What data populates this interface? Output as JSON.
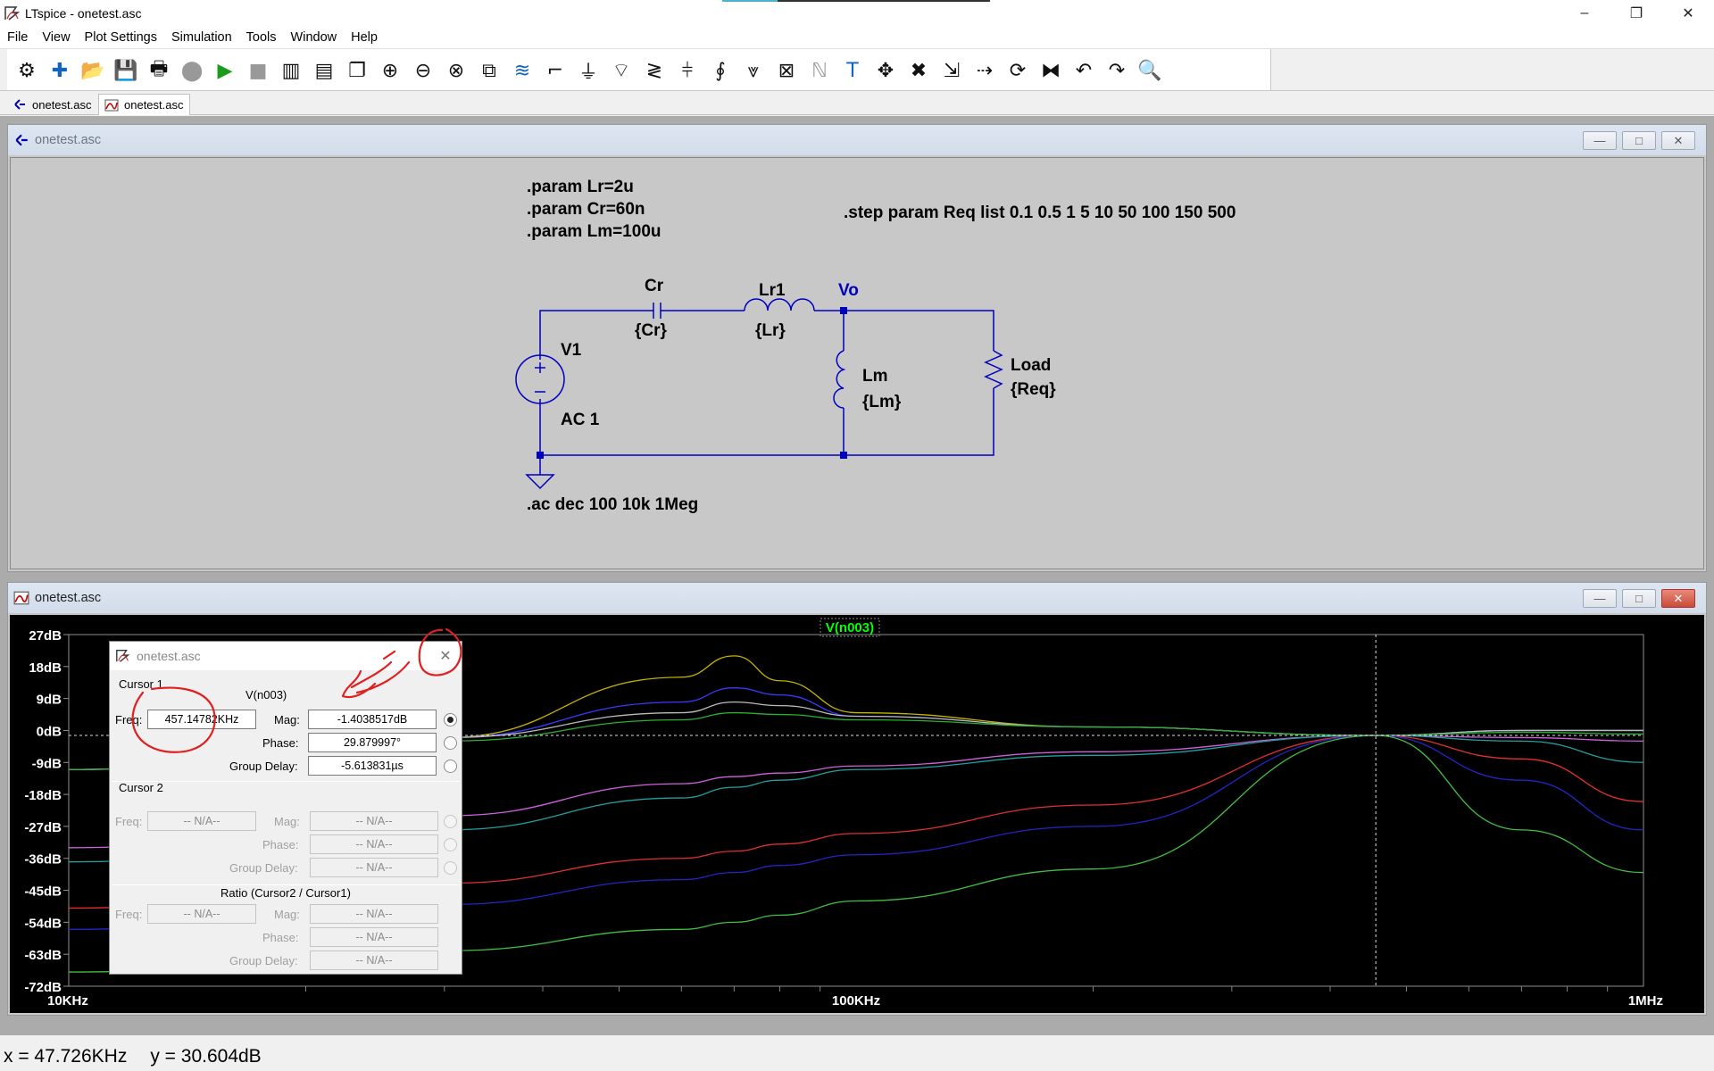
{
  "window": {
    "title": "LTspice - onetest.asc"
  },
  "menu": [
    "File",
    "View",
    "Plot Settings",
    "Simulation",
    "Tools",
    "Window",
    "Help"
  ],
  "toolbar": {
    "icons": [
      "gear-icon",
      "new-schematic-icon",
      "open-icon",
      "save-icon",
      "print-icon",
      "halt-icon",
      "run-icon",
      "stop-icon",
      "tile-vertical-icon",
      "tile-horizontal-icon",
      "cascade-icon",
      "zoom-in-icon",
      "zoom-out-icon",
      "zoom-fit-icon",
      "zoom-extents-icon",
      "autorange-icon",
      "wire-icon",
      "ground-icon",
      "label-net-icon",
      "resistor-icon",
      "capacitor-icon",
      "inductor-icon",
      "diode-icon",
      "component-icon",
      "spice-directive-icon",
      "text-icon",
      "move-icon",
      "delete-icon",
      "duplicate-icon",
      "drag-icon",
      "rotate-icon",
      "mirror-icon",
      "undo-icon",
      "redo-icon",
      "find-icon"
    ]
  },
  "tabs": [
    {
      "label": "onetest.asc",
      "icon": "schematic-icon"
    },
    {
      "label": "onetest.asc",
      "icon": "waveform-icon",
      "active": true
    }
  ],
  "schematic": {
    "title": "onetest.asc",
    "directives": [
      ".param Lr=2u",
      ".param Cr=60n",
      ".param Lm=100u"
    ],
    "step": ".step param Req list 0.1 0.5 1 5 10 50 100 150 500",
    "ac": ".ac dec 100 10k 1Meg",
    "components": {
      "cr_name": "Cr",
      "cr_value": "{Cr}",
      "lr_name": "Lr1",
      "lr_value": "{Lr}",
      "vo_label": "Vo",
      "lm_name": "Lm",
      "lm_value": "{Lm}",
      "load_name": "Load",
      "load_value": "{Req}",
      "v1_name": "V1",
      "v1_value": "AC 1"
    },
    "colors": {
      "wire": "#0000c0",
      "text": "#000000",
      "background": "#c8c8c8"
    }
  },
  "plot": {
    "title": "onetest.asc",
    "trace_label": "V(n003)",
    "y_ticks": [
      "27dB",
      "18dB",
      "9dB",
      "0dB",
      "-9dB",
      "-18dB",
      "-27dB",
      "-36dB",
      "-45dB",
      "-54dB",
      "-63dB",
      "-72dB"
    ],
    "x_ticks": [
      "10KHz",
      "100KHz",
      "1MHz"
    ],
    "colors": {
      "background": "#000000",
      "grid": "#808080",
      "trace_label": "#00ff00",
      "axis_text": "#ffffff"
    }
  },
  "chart_data": {
    "type": "line",
    "title": "V(n003)",
    "xlabel": "",
    "ylabel": "",
    "x_scale": "log",
    "xlim": [
      10000,
      1000000
    ],
    "ylim": [
      -72,
      27
    ],
    "cursor_x": 457147.82,
    "x": [
      10000,
      30000,
      60000,
      70000,
      80000,
      100000,
      200000,
      457148,
      700000,
      1000000
    ],
    "series": [
      {
        "color": "#c8b400",
        "values": [
          -11,
          -2,
          15,
          21,
          14,
          5,
          1,
          -1.4,
          0,
          0
        ]
      },
      {
        "color": "#3a3aff",
        "values": [
          -11,
          -2,
          8,
          12,
          10,
          4,
          1,
          -1.4,
          0,
          0
        ]
      },
      {
        "color": "#bbbbbb",
        "values": [
          -11,
          -2,
          5,
          8,
          7,
          4,
          1,
          -1.4,
          0,
          0
        ]
      },
      {
        "color": "#2ab030",
        "values": [
          -11,
          -3,
          3,
          5,
          4.5,
          3,
          1,
          -1.4,
          -0.5,
          -1
        ]
      },
      {
        "color": "#d060e0",
        "values": [
          -33,
          -24,
          -15,
          -13,
          -12,
          -10,
          -6,
          -1.4,
          -2,
          -3
        ]
      },
      {
        "color": "#20a0a0",
        "values": [
          -37,
          -28,
          -19,
          -16,
          -14,
          -11,
          -7,
          -1.4,
          -3,
          -9
        ]
      },
      {
        "color": "#e03030",
        "values": [
          -50,
          -43,
          -36,
          -34,
          -32,
          -29,
          -21,
          -1.4,
          -8,
          -20
        ]
      },
      {
        "color": "#2424c8",
        "values": [
          -56,
          -49,
          -42,
          -40,
          -38,
          -35,
          -27,
          -1.4,
          -14,
          -28
        ]
      },
      {
        "color": "#40c040",
        "values": [
          -68,
          -62,
          -56,
          -54,
          -52,
          -48,
          -39,
          -1.4,
          -28,
          -40
        ]
      }
    ]
  },
  "cursor_dialog": {
    "title": "onetest.asc",
    "cursor1_label": "Cursor 1",
    "trace": "V(n003)",
    "freq_label": "Freq:",
    "freq": "457.14782KHz",
    "mag_label": "Mag:",
    "mag": "-1.4038517dB",
    "phase_label": "Phase:",
    "phase": "29.879997°",
    "gd_label": "Group Delay:",
    "group_delay": "-5.613831µs",
    "cursor2_label": "Cursor 2",
    "na": "-- N/A--",
    "ratio_label": "Ratio (Cursor2 / Cursor1)"
  },
  "status": {
    "x": "x = 47.726KHz",
    "y": "y = 30.604dB"
  }
}
